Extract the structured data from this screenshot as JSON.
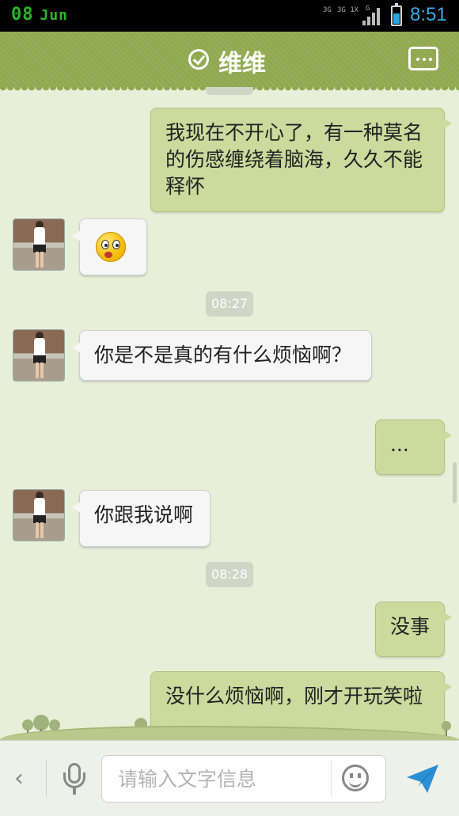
{
  "status_bar": {
    "date_day": "08",
    "date_month": "Jun",
    "signal_1": "3G",
    "signal_2": "3G 1X",
    "signal_3": "G",
    "time": "8:51"
  },
  "header": {
    "title": "维维",
    "title_icon": "check-circle-icon",
    "menu_icon": "more-icon"
  },
  "messages": [
    {
      "side": "out",
      "text": "我现在不开心了，有一种莫名的伤感缠绕着脑海，久久不能释怀"
    },
    {
      "side": "in",
      "type": "emoji",
      "emoji": "surprised-face-icon"
    },
    {
      "type": "time",
      "text": "08:27"
    },
    {
      "side": "in",
      "text": "你是不是真的有什么烦恼啊？"
    },
    {
      "side": "out",
      "text": "..."
    },
    {
      "side": "in",
      "text": "你跟我说啊"
    },
    {
      "type": "time",
      "text": "08:28"
    },
    {
      "side": "out",
      "text": "没事"
    },
    {
      "side": "out",
      "text": "没什么烦恼啊，刚才开玩笑啦"
    }
  ],
  "input_bar": {
    "back_label": "‹",
    "placeholder": "请输入文字信息",
    "value": "",
    "icons": [
      "back-arrow-icon",
      "microphone-icon",
      "emoji-icon",
      "send-icon"
    ]
  },
  "colors": {
    "header": "#8fa94f",
    "outgoing_bubble": "#cbda9d",
    "incoming_bubble": "#f6f6f6",
    "background": "#e7efd9",
    "clock": "#33aee8"
  }
}
